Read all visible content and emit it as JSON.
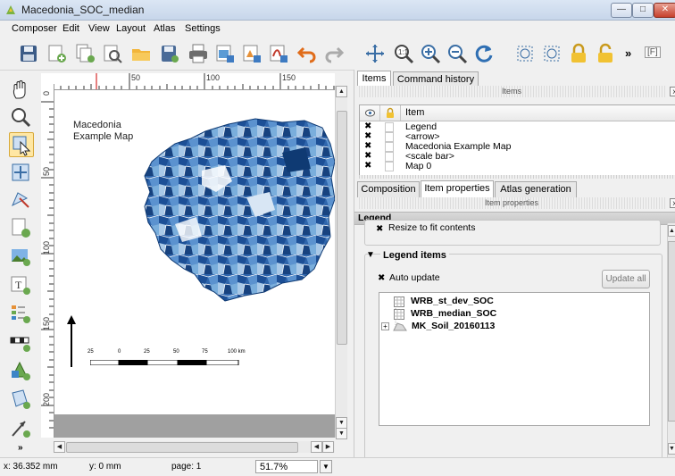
{
  "window": {
    "title": "Macedonia_SOC_median"
  },
  "menu": [
    "Composer",
    "Edit",
    "View",
    "Layout",
    "Atlas",
    "Settings"
  ],
  "toolbar": {
    "icons": [
      "save-icon",
      "new-composer-icon",
      "duplicate-composer-icon",
      "composer-manager-icon",
      "open-folder-icon",
      "save-template-icon",
      "print-icon",
      "export-image-icon",
      "export-svg-icon",
      "export-pdf-icon",
      "undo-icon",
      "redo-icon",
      "pan-icon",
      "zoom-full-icon",
      "zoom-in-icon",
      "zoom-out-icon",
      "refresh-icon",
      "lock-icon",
      "unlock-icon"
    ],
    "overflow": "»",
    "extra": "[F]"
  },
  "rulers": {
    "h_labels": [
      "50",
      "100",
      "150"
    ],
    "v_labels": [
      "0",
      "50",
      "100",
      "150",
      "200"
    ]
  },
  "canvas": {
    "label_line1": "Macedonia",
    "label_line2": "Example Map",
    "scale_labels": [
      "25",
      "0",
      "25",
      "50",
      "75",
      "100 km"
    ]
  },
  "status": {
    "x": "x: 36.352 mm",
    "y": "y: 0 mm",
    "page": "page: 1",
    "zoom": "51.7%"
  },
  "items_panel": {
    "tabs": [
      "Items",
      "Command history"
    ],
    "header": "Items",
    "column_item": "Item",
    "rows": [
      {
        "name": "Legend"
      },
      {
        "name": "<arrow>"
      },
      {
        "name": "Macedonia Example Map"
      },
      {
        "name": "<scale bar>"
      },
      {
        "name": "Map 0"
      }
    ]
  },
  "props_panel": {
    "tabs": [
      "Composition",
      "Item properties",
      "Atlas generation"
    ],
    "header": "Item properties",
    "section_title": "Legend",
    "resize_label": "Resize to fit contents",
    "legend_items_title": "Legend items",
    "auto_update_label": "Auto update",
    "update_all_label": "Update all",
    "tree": [
      {
        "label": "WRB_st_dev_SOC"
      },
      {
        "label": "WRB_median_SOC"
      },
      {
        "label": "MK_Soil_20160113"
      }
    ]
  },
  "colors": {
    "map_dark": "#1c4f96",
    "map_mid": "#3f7cc2",
    "map_light": "#a9c9e8",
    "accent_yellow": "#ffe7a3"
  }
}
